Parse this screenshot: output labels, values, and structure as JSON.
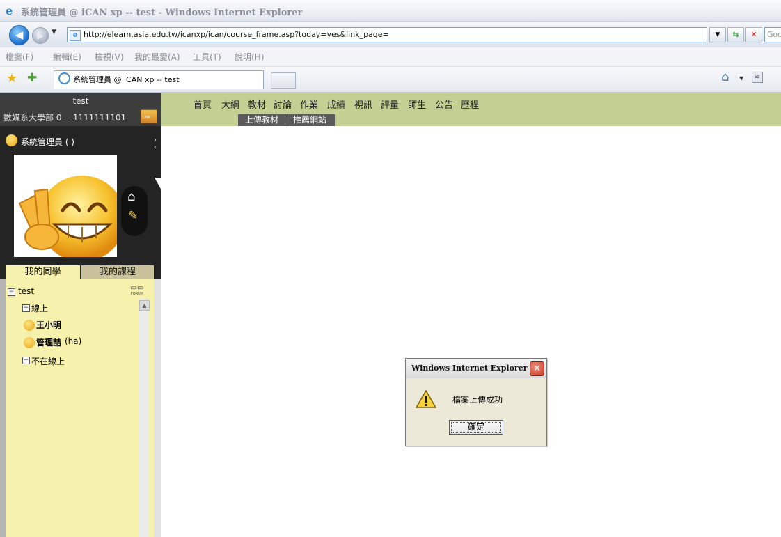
{
  "window": {
    "title": "系統管理員 @ iCAN xp -- test - Windows Internet Explorer"
  },
  "address": {
    "url": "http://elearn.asia.edu.tw/icanxp/ican/course_frame.asp?today=yes&link_page=",
    "search_placeholder": "Goo"
  },
  "menu": {
    "items": [
      "檔案(F)",
      "編輯(E)",
      "檢視(V)",
      "我的最愛(A)",
      "工具(T)",
      "說明(H)"
    ]
  },
  "tab": {
    "label": "系統管理員 @ iCAN xp -- test"
  },
  "side_header": {
    "course": "test",
    "dept": "數媒系大學部 0 -- 1111111101",
    "link_badge": "LINK"
  },
  "profile": {
    "name": "系統管理員 ( )"
  },
  "side_tabs": {
    "classmates": "我的同學",
    "courses": "我的課程"
  },
  "tree": {
    "root": "test",
    "forum_label": "FORUM",
    "online": "線上",
    "users": [
      {
        "name": "王小明",
        "extra": ""
      },
      {
        "name": "管理喆",
        "extra": "(ha)"
      }
    ],
    "offline": "不在線上"
  },
  "main_nav": {
    "links": [
      "首頁",
      "大綱",
      "教材",
      "討論",
      "作業",
      "成績",
      "視訊",
      "評量",
      "師生",
      "公告",
      "歷程"
    ]
  },
  "subnav": {
    "links": [
      "上傳教材",
      "推薦網站"
    ]
  },
  "dialog": {
    "title": "Windows Internet Explorer",
    "message": "檔案上傳成功",
    "ok": "確定"
  },
  "colors": {
    "nav_bg": "#c3d094",
    "sidebar_bg": "#242424",
    "panel_bg": "#f6f1ad"
  }
}
